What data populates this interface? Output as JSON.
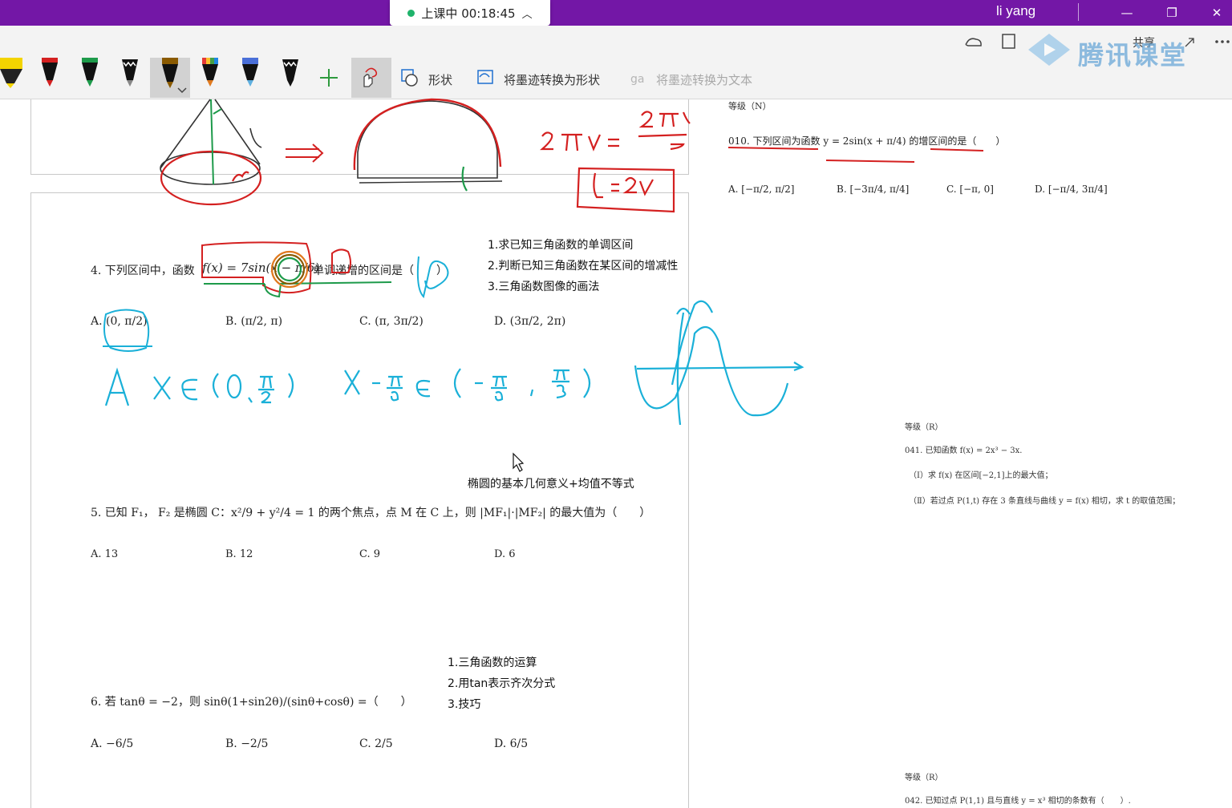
{
  "titlebar": {
    "class_status": "上课中 00:18:45",
    "user_name": "li yang",
    "accent_color": "#7317a6"
  },
  "ribbon": {
    "shape_label": "形状",
    "ink_to_shape_label": "将墨迹转换为形状",
    "ink_to_text_label": "将墨迹转换为文本",
    "watermark": "腾讯课堂",
    "share_label": "共享"
  },
  "right_panel": {
    "level_n": "等级（N）",
    "q010": "010. 下列区间为函数 y = 2sin(x + π/4) 的增区间的是（　　）",
    "q010_options": [
      "A. [−π/2, π/2]",
      "B. [−3π/4, π/4]",
      "C. [−π, 0]",
      "D. [−π/4, 3π/4]"
    ],
    "level_r1": "等级（R）",
    "q041": "041. 已知函数 f(x) = 2x³ − 3x.",
    "q041_1": "（Ⅰ）求 f(x) 在区间[−2,1]上的最大值；",
    "q041_2": "（Ⅱ）若过点 P(1,t) 存在 3 条直线与曲线 y = f(x) 相切，求 t 的取值范围；",
    "level_r2": "等级（R）",
    "q042": "042. 已知过点 P(1,1) 且与直线 y = x³ 相切的条数有（　　）."
  },
  "page": {
    "q4_prefix": "4. 下列区间中，函数",
    "q4_func": "f(x) = 7sin(x − π/6)",
    "q4_suffix": "单调递增的区间是（　　）",
    "q4_options": [
      "A. (0, π/2)",
      "B. (π/2, π)",
      "C. (π, 3π/2)",
      "D. (3π/2, 2π)"
    ],
    "notes_q4": [
      "1.求已知三角函数的单调区间",
      "2.判断已知三角函数在某区间的增减性",
      "3.三角函数图像的画法"
    ],
    "note_q5": "椭圆的基本几何意义+均值不等式",
    "q5_text": "5. 已知 F₁， F₂ 是椭圆 C：x²/9 + y²/4 = 1 的两个焦点，点 M 在 C 上，则 |MF₁|·|MF₂| 的最大值为（　　）",
    "q5_options": [
      "A. 13",
      "B. 12",
      "C. 9",
      "D. 6"
    ],
    "notes_q6": [
      "1.三角函数的运算",
      "2.用tan表示齐次分式",
      "3.技巧"
    ],
    "q6_text": "6. 若 tanθ = −2，则 sinθ(1+sin2θ)/(sinθ+cosθ) =（　　）",
    "q6_options": [
      "A. −6/5",
      "B. −2/5",
      "C. 2/5",
      "D. 6/5"
    ]
  }
}
